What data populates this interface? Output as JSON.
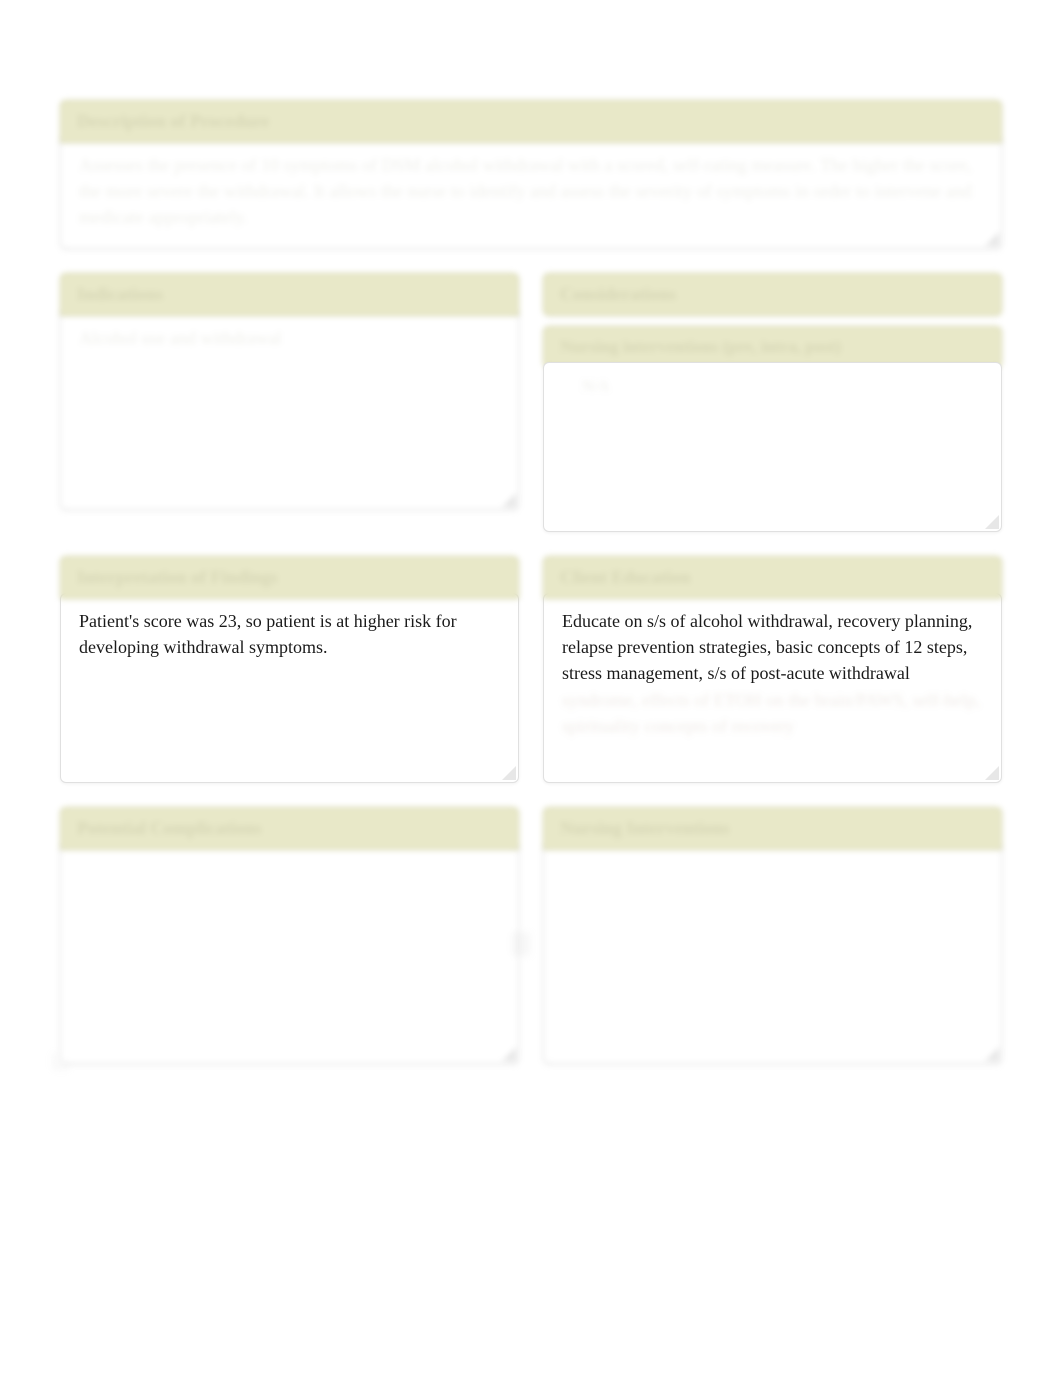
{
  "description": {
    "header": "Description of Procedure",
    "body": "Assesses the presence of 10 symptoms of DSM alcohol withdrawal with a scored, self-rating measure. The higher the score, the more severe the withdrawal. It allows the nurse to identify and assess the severity of symptoms in order to intervene and medicate appropriately."
  },
  "row1": {
    "indications": {
      "header": "Indications",
      "body": "Alcohol use and withdrawal"
    },
    "considerations": {
      "header": "Considerations",
      "inner_header": "Nursing interventions (pre, intra, post)",
      "body": "N/A"
    }
  },
  "row2": {
    "interpretation": {
      "header": "Interpretation of Findings",
      "body": "Patient's score was 23, so patient is at higher risk for developing withdrawal symptoms."
    },
    "education": {
      "header": "Client Education",
      "body_visible": "Educate on s/s of alcohol withdrawal, recovery planning, relapse prevention strategies, basic concepts of 12 steps, stress management, s/s of post-acute withdrawal",
      "body_blurred": "syndrome, effects of ETOH on the brain/PAWS, self-help, spirituality concepts of recovery"
    }
  },
  "row3": {
    "complications": {
      "header": "Potential Complications",
      "body": ""
    },
    "nursing": {
      "header": "Nursing Interventions",
      "body": ""
    }
  }
}
